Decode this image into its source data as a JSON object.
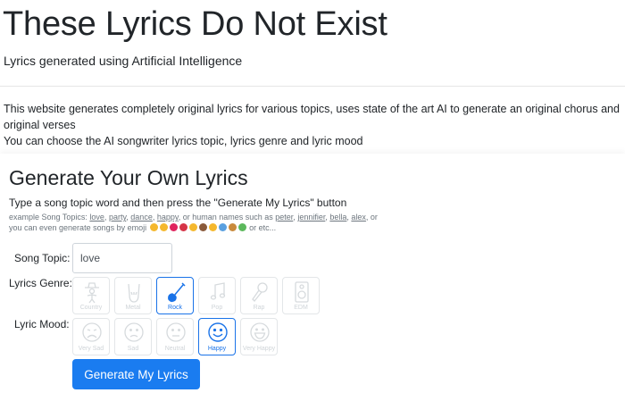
{
  "header": {
    "title": "These Lyrics Do Not Exist",
    "subtitle": "Lyrics generated using Artificial Intelligence"
  },
  "intro": {
    "line1": "This website generates completely original lyrics for various topics, uses state of the art AI to generate an original chorus and original verses",
    "line2": "You can choose the AI songwriter lyrics topic, lyrics genre and lyric mood"
  },
  "generator": {
    "title": "Generate Your Own Lyrics",
    "instruction": "Type a song topic word and then press the \"Generate My Lyrics\" button",
    "examples": {
      "prefix": "example Song Topics:",
      "topics": [
        "love",
        "party",
        "dance",
        "happy"
      ],
      "names_text": ", or human names such as",
      "names": [
        "peter",
        "jennifier",
        "bella",
        "alex"
      ],
      "emoji_text": ", or you can even generate songs by emoji",
      "suffix": "or etc...",
      "emoji_colors": [
        "#f5b82e",
        "#f5b82e",
        "#e0245e",
        "#d63447",
        "#f5b82e",
        "#8a5a3b",
        "#f5b82e",
        "#5aa0e0",
        "#c98a3c",
        "#5cb85c"
      ]
    },
    "song_topic": {
      "label": "Song Topic:",
      "value": "love",
      "placeholder": ""
    },
    "genre": {
      "label": "Lyrics Genre:",
      "selected": "Rock",
      "options": [
        {
          "name": "Country",
          "icon": "cowboy-icon"
        },
        {
          "name": "Metal",
          "icon": "rock-hand-icon"
        },
        {
          "name": "Rock",
          "icon": "guitar-icon"
        },
        {
          "name": "Pop",
          "icon": "music-note-icon"
        },
        {
          "name": "Rap",
          "icon": "microphone-icon"
        },
        {
          "name": "EDM",
          "icon": "speaker-icon"
        }
      ]
    },
    "mood": {
      "label": "Lyric Mood:",
      "selected": "Happy",
      "options": [
        {
          "name": "Very Sad",
          "icon": "very-sad-face-icon"
        },
        {
          "name": "Sad",
          "icon": "sad-face-icon"
        },
        {
          "name": "Neutral",
          "icon": "neutral-face-icon"
        },
        {
          "name": "Happy",
          "icon": "happy-face-icon"
        },
        {
          "name": "Very Happy",
          "icon": "very-happy-face-icon"
        }
      ]
    },
    "button_label": "Generate My Lyrics",
    "colors": {
      "accent": "#1a7cf0",
      "selected_border": "#1a73e8",
      "muted_icon": "#d6dadd"
    }
  }
}
